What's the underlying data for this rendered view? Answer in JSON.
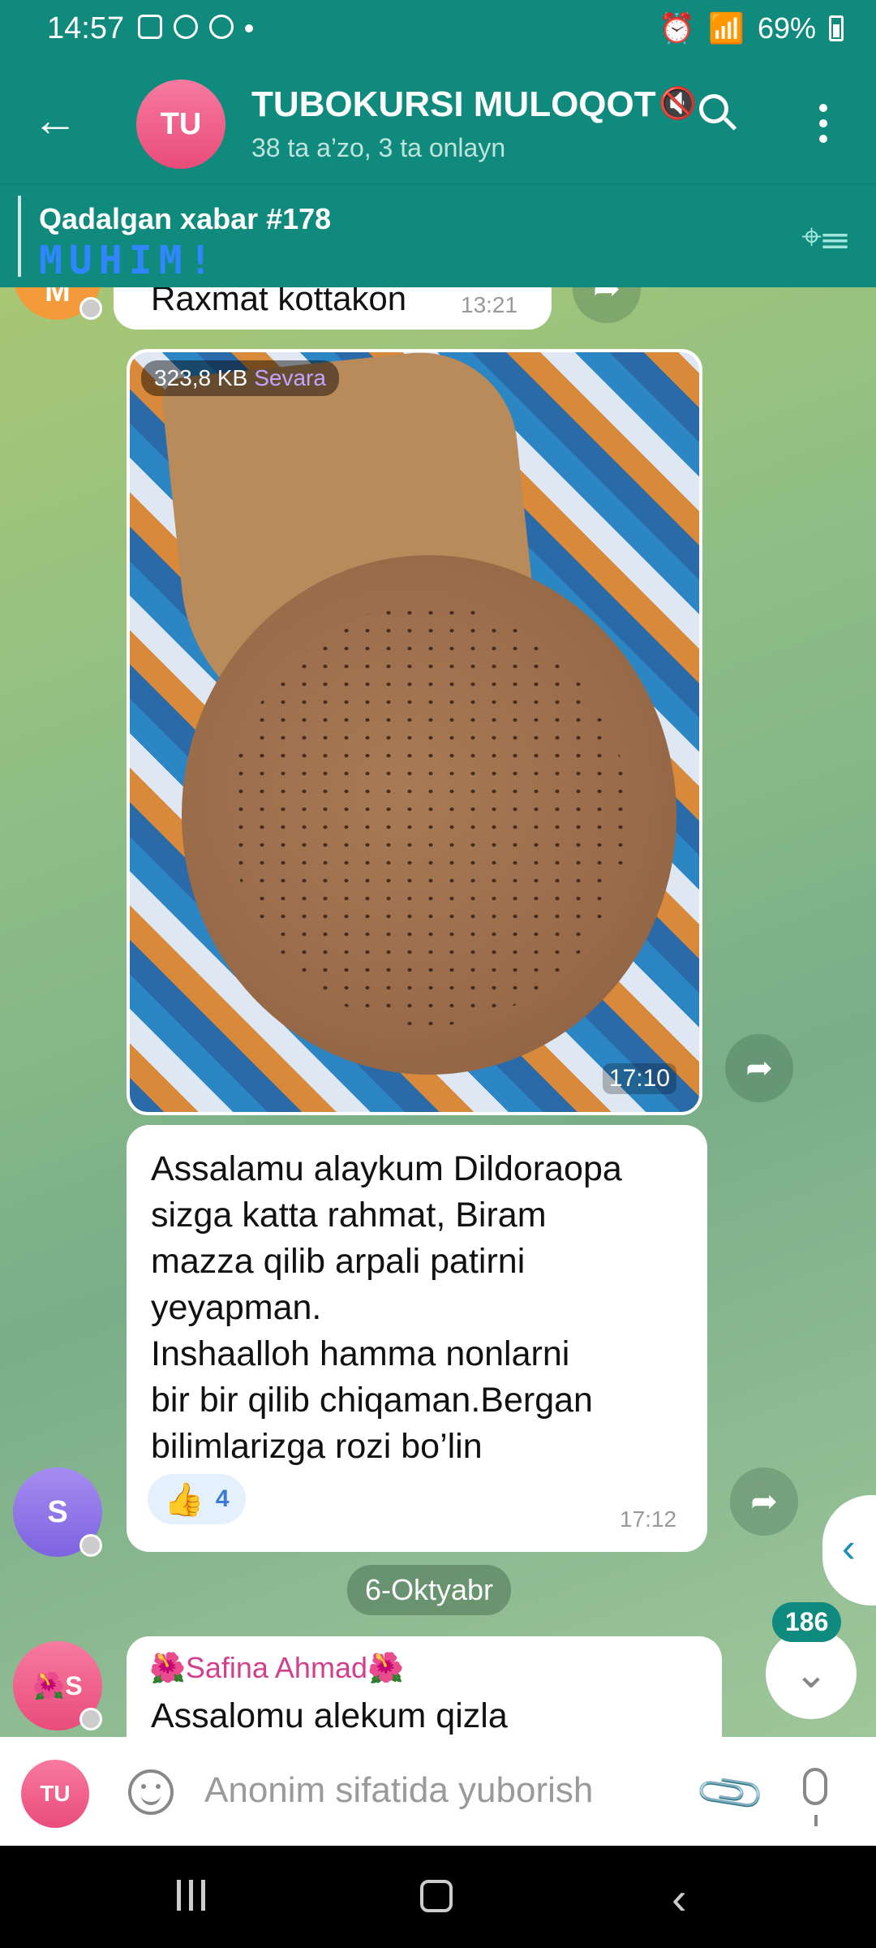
{
  "status_bar": {
    "time": "14:57",
    "battery": "69%"
  },
  "header": {
    "avatar_initials": "TU",
    "title": "TUBOKURSI MULOQOT",
    "subtitle": "38 ta a’zo, 3 ta onlayn"
  },
  "pinned": {
    "title": "Qadalgan xabar #178",
    "text": "MUHIM!"
  },
  "messages": {
    "first": {
      "avatar": "M",
      "text": "Raxmat kottakon",
      "time": "13:21"
    },
    "photo": {
      "size": "323,8 KB",
      "sender": "Sevara",
      "time": "17:10"
    },
    "text_msg": {
      "avatar": "S",
      "text": "Assalamu alaykum Dildoraopa\nsizga katta rahmat, Biram\nmazza qilib arpali patirni\nyeyapman.\nInshaalloh hamma nonlarni\nbir bir qilib chiqaman.Bergan\nbilimlarizga rozi bo’lin",
      "reaction_count": "4",
      "time": "17:12"
    },
    "date_separator": "6-Oktyabr",
    "last": {
      "avatar": "🌺S",
      "sender": "🌺Safina Ahmad🌺",
      "text": "Assalomu alekum qizla"
    }
  },
  "unread_count": "186",
  "input": {
    "avatar_initials": "TU",
    "placeholder": "Anonim sifatida yuborish"
  }
}
